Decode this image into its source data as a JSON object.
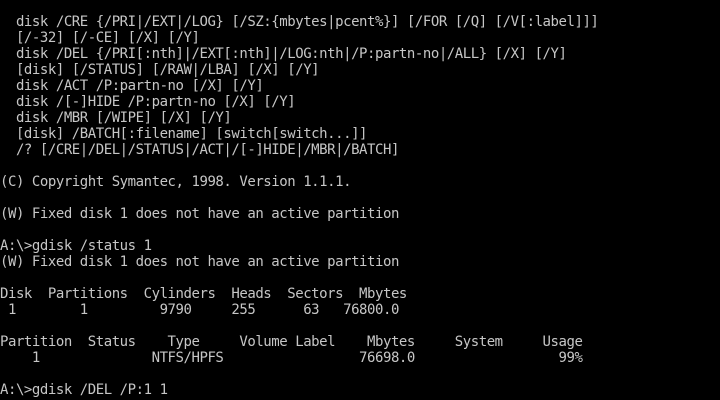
{
  "screen": {
    "background": "#000000",
    "foreground": "#c6c6c6"
  },
  "syntax": [
    "  disk /CRE {/PRI|/EXT|/LOG} [/SZ:{mbytes|pcent%}] [/FOR [/Q] [/V[:label]]]",
    "  [/-32] [/-CE] [/X] [/Y]",
    "  disk /DEL {/PRI[:nth]|/EXT[:nth]|/LOG:nth|/P:partn-no|/ALL} [/X] [/Y]",
    "  [disk] [/STATUS] [/RAW|/LBA] [/X] [/Y]",
    "  disk /ACT /P:partn-no [/X] [/Y]",
    "  disk /[-]HIDE /P:partn-no [/X] [/Y]",
    "  disk /MBR [/WIPE] [/X] [/Y]",
    "  [disk] /BATCH[:filename] [switch[switch...]]",
    "  /? [/CRE|/DEL|/STATUS|/ACT|/[-]HIDE|/MBR|/BATCH]"
  ],
  "copyright": "(C) Copyright Symantec, 1998. Version 1.1.1.",
  "warning_1": "(W) Fixed disk 1 does not have an active partition",
  "command_1": "A:\\>gdisk /status 1",
  "warning_2": "(W) Fixed disk 1 does not have an active partition",
  "disk_table": {
    "header": "Disk  Partitions  Cylinders  Heads  Sectors  Mbytes",
    "row": " 1        1         9790     255      63   76800.0"
  },
  "partition_table": {
    "header": "Partition  Status    Type     Volume Label    Mbytes     System     Usage",
    "row": "    1              NTFS/HPFS                 76698.0                  99%"
  },
  "command_2": "A:\\>gdisk /DEL /P:1 1"
}
